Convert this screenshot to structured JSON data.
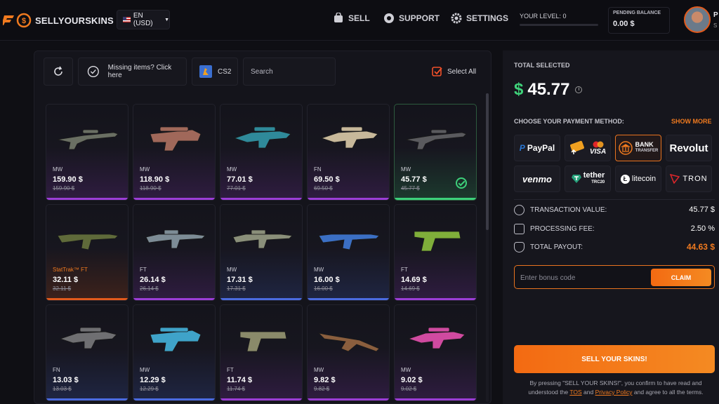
{
  "header": {
    "logo_text": "SELLYOURSKINS",
    "language": "EN (USD)",
    "nav": {
      "sell": "SELL",
      "support": "SUPPORT",
      "settings": "SETTINGS"
    },
    "level_label": "YOUR LEVEL: 0",
    "pending_label": "PENDING BALANCE",
    "pending_value": "0.00 $",
    "user_initial": "P",
    "user_sub": "S"
  },
  "toolbar": {
    "missing_items": "Missing items? Click here",
    "game": "CS2",
    "search_placeholder": "Search",
    "select_all": "Select All"
  },
  "items": [
    {
      "wear": "MW",
      "price": "159.90 $",
      "old": "159.90 $",
      "rarity": "#9b3dd6",
      "weapon": "awp",
      "color": "#6a6f63",
      "selected": false
    },
    {
      "wear": "MW",
      "price": "118.90 $",
      "old": "118.90 $",
      "rarity": "#9b3dd6",
      "weapon": "p90",
      "color": "#a0685a",
      "selected": false
    },
    {
      "wear": "MW",
      "price": "77.01 $",
      "old": "77.01 $",
      "rarity": "#9b3dd6",
      "weapon": "famas",
      "color": "#2f8a9a",
      "selected": false
    },
    {
      "wear": "FN",
      "price": "69.50 $",
      "old": "69.50 $",
      "rarity": "#9b3dd6",
      "weapon": "famas",
      "color": "#c7b89a",
      "selected": false
    },
    {
      "wear": "MW",
      "price": "45.77 $",
      "old": "45.77 $",
      "rarity": "#3dd07a",
      "weapon": "awp",
      "color": "#5a5a5e",
      "selected": true
    },
    {
      "wear": "StatTrak™ FT",
      "price": "32.11 $",
      "old": "32.11 $",
      "rarity": "#e25a1c",
      "weapon": "ak",
      "color": "#5f6a3a",
      "selected": false,
      "stattrak": true
    },
    {
      "wear": "FT",
      "price": "26.14 $",
      "old": "26.14 $",
      "rarity": "#9b3dd6",
      "weapon": "m4",
      "color": "#7d8c96",
      "selected": false
    },
    {
      "wear": "MW",
      "price": "17.31 $",
      "old": "17.31 $",
      "rarity": "#4b6be0",
      "weapon": "m4",
      "color": "#8a8f7a",
      "selected": false
    },
    {
      "wear": "MW",
      "price": "16.00 $",
      "old": "16.00 $",
      "rarity": "#4b6be0",
      "weapon": "ak",
      "color": "#3b6fc4",
      "selected": false
    },
    {
      "wear": "FT",
      "price": "14.69 $",
      "old": "14.69 $",
      "rarity": "#9b3dd6",
      "weapon": "pistol",
      "color": "#7fae3a",
      "selected": false
    },
    {
      "wear": "FN",
      "price": "13.03 $",
      "old": "13.03 $",
      "rarity": "#4b6be0",
      "weapon": "famas",
      "color": "#6f6f72",
      "selected": false
    },
    {
      "wear": "MW",
      "price": "12.29 $",
      "old": "12.29 $",
      "rarity": "#4b6be0",
      "weapon": "p90",
      "color": "#3fa3c9",
      "selected": false
    },
    {
      "wear": "FT",
      "price": "11.74 $",
      "old": "11.74 $",
      "rarity": "#9b3dd6",
      "weapon": "pistol",
      "color": "#8a8a6a",
      "selected": false
    },
    {
      "wear": "MW",
      "price": "9.82 $",
      "old": "9.82 $",
      "rarity": "#9b3dd6",
      "weapon": "sg",
      "color": "#8a5e3e",
      "selected": false
    },
    {
      "wear": "MW",
      "price": "9.02 $",
      "old": "9.02 $",
      "rarity": "#9b3dd6",
      "weapon": "famas",
      "color": "#d04aa0",
      "selected": false
    }
  ],
  "side": {
    "total_label": "TOTAL SELECTED",
    "currency": "$",
    "total_value": "45.77",
    "payment_title": "CHOOSE YOUR PAYMENT METHOD:",
    "show_more": "SHOW MORE",
    "methods": {
      "paypal": "PayPal",
      "visa": "VISA",
      "bank_top": "BANK",
      "bank_bottom": "TRANSFER",
      "revolut": "Revolut",
      "venmo": "venmo",
      "tether": "tether",
      "tether_sub": "TRC20",
      "litecoin": "litecoin",
      "tron": "TRON"
    },
    "transaction_label": "TRANSACTION VALUE:",
    "transaction_value": "45.77 $",
    "fee_label": "PROCESSING FEE:",
    "fee_value": "2.50 %",
    "payout_label": "TOTAL PAYOUT:",
    "payout_value": "44.63 $",
    "bonus_placeholder": "Enter bonus code",
    "claim": "CLAIM",
    "sell_button": "SELL YOUR SKINS!",
    "legal_1": "By pressing \"SELL YOUR SKINS!\", you confirm to have read and understood the",
    "tos": "TOS",
    "and": "and",
    "privacy": "Privacy Policy",
    "legal_2": "and agree to all the terms."
  },
  "colors": {
    "accent": "#f07a1f",
    "green": "#3fd27a"
  }
}
